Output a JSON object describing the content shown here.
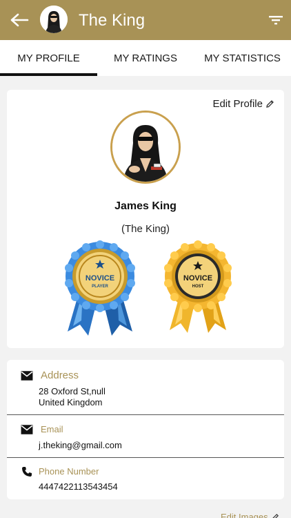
{
  "appbar": {
    "title": "The King",
    "back_icon": "arrow-left-icon",
    "filter_icon": "filter-icon",
    "background": "#a89256"
  },
  "tabs": [
    {
      "label": "MY PROFILE",
      "active": true
    },
    {
      "label": "MY RATINGS",
      "active": false
    },
    {
      "label": "MY STATISTICS",
      "active": false
    }
  ],
  "profile": {
    "edit_label": "Edit Profile",
    "name": "James King",
    "nickname": "(The King)",
    "badges": [
      {
        "line1": "NOVICE",
        "line2": "PLAYER",
        "color": "#2f7fd0"
      },
      {
        "line1": "NOVICE",
        "line2": "HOST",
        "color": "#e0a020"
      }
    ]
  },
  "details": {
    "address": {
      "label": "Address",
      "line1": "28 Oxford St,null",
      "line2": "United Kingdom"
    },
    "email": {
      "label": "Email",
      "value": "j.theking@gmail.com"
    },
    "phone": {
      "label": "Phone Number",
      "value": "4447422113543454"
    }
  },
  "images": {
    "edit_label": "Edit Images"
  },
  "colors": {
    "accent": "#a89256",
    "gold_ring": "#c9a04e"
  }
}
